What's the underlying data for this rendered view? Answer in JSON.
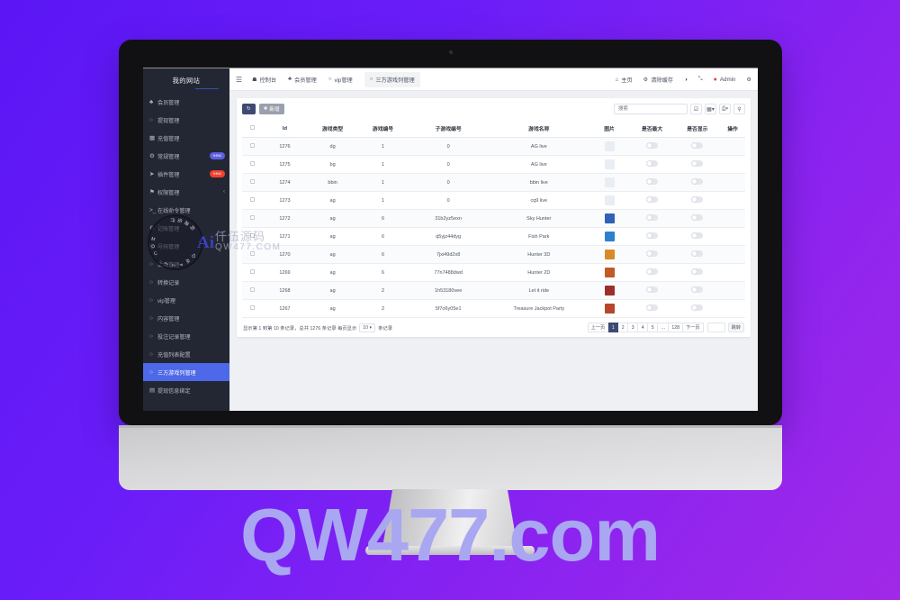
{
  "watermarks": {
    "bottom": "QW477.com",
    "circle_ring_top": "仟伍源码",
    "circle_ring_bottom": "QW477.COM",
    "logo": "Ai",
    "brand_cn": "仟伍源码",
    "brand_url": "QW477.COM"
  },
  "sidebar": {
    "brand": "我的网站",
    "items": [
      {
        "icon": "users-icon",
        "glyph": "♣",
        "label": "会员管理",
        "badge": "",
        "badge_color": "",
        "active": false,
        "chevron": ""
      },
      {
        "icon": "circle-icon",
        "glyph": "○",
        "label": "提现管理",
        "badge": "",
        "badge_color": "",
        "active": false,
        "chevron": ""
      },
      {
        "icon": "grid-icon",
        "glyph": "▦",
        "label": "充值管理",
        "badge": "",
        "badge_color": "",
        "active": false,
        "chevron": ""
      },
      {
        "icon": "gear-icon",
        "glyph": "⚙",
        "label": "常规管理",
        "badge": "new",
        "badge_color": "purple",
        "active": false,
        "chevron": ""
      },
      {
        "icon": "rocket-icon",
        "glyph": "➤",
        "label": "插件管理",
        "badge": "new",
        "badge_color": "red",
        "active": false,
        "chevron": ""
      },
      {
        "icon": "shield-icon",
        "glyph": "⚑",
        "label": "权限管理",
        "badge": "",
        "badge_color": "",
        "active": false,
        "chevron": "‹"
      },
      {
        "icon": "terminal-icon",
        "glyph": ">_",
        "label": "在线命令管理",
        "badge": "",
        "badge_color": "",
        "active": false,
        "chevron": ""
      },
      {
        "icon": "gear-icon",
        "glyph": "⚙",
        "label": "记账管理",
        "badge": "",
        "badge_color": "",
        "active": false,
        "chevron": ""
      },
      {
        "icon": "cart-icon",
        "glyph": "◎",
        "label": "号码管理",
        "badge": "",
        "badge_color": "",
        "active": false,
        "chevron": ""
      },
      {
        "icon": "circle-icon",
        "glyph": "○",
        "label": "活动管理",
        "badge": "",
        "badge_color": "",
        "active": false,
        "chevron": ""
      },
      {
        "icon": "circle-icon",
        "glyph": "○",
        "label": "转换记录",
        "badge": "",
        "badge_color": "",
        "active": false,
        "chevron": ""
      },
      {
        "icon": "circle-icon",
        "glyph": "○",
        "label": "vip管理",
        "badge": "",
        "badge_color": "",
        "active": false,
        "chevron": ""
      },
      {
        "icon": "circle-icon",
        "glyph": "○",
        "label": "内容管理",
        "badge": "",
        "badge_color": "",
        "active": false,
        "chevron": ""
      },
      {
        "icon": "circle-icon",
        "glyph": "○",
        "label": "投注记录管理",
        "badge": "",
        "badge_color": "",
        "active": false,
        "chevron": ""
      },
      {
        "icon": "circle-icon",
        "glyph": "○",
        "label": "充值列表配置",
        "badge": "",
        "badge_color": "",
        "active": false,
        "chevron": ""
      },
      {
        "icon": "circle-icon",
        "glyph": "○",
        "label": "三方游戏列管理",
        "badge": "",
        "badge_color": "",
        "active": true,
        "chevron": ""
      },
      {
        "icon": "bank-icon",
        "glyph": "▤",
        "label": "提现信息绑定",
        "badge": "",
        "badge_color": "",
        "active": false,
        "chevron": ""
      }
    ]
  },
  "topbar": {
    "menu_icon": "hamburger-icon",
    "left_items": [
      {
        "icon": "dashboard-icon",
        "glyph": "☗",
        "label": "控制台",
        "active": false
      },
      {
        "icon": "users-icon",
        "glyph": "♣",
        "label": "会员管理",
        "active": false
      },
      {
        "icon": "circle-icon",
        "glyph": "○",
        "label": "vip管理",
        "active": false
      },
      {
        "icon": "circle-icon",
        "glyph": "○",
        "label": "三方游戏列管理",
        "active": true
      }
    ],
    "right_items": [
      {
        "icon": "home-icon",
        "glyph": "⌂",
        "label": "主页"
      },
      {
        "icon": "broom-icon",
        "glyph": "⚙",
        "label": "清除缓存"
      },
      {
        "icon": "theme-icon",
        "glyph": "◑",
        "label": ""
      },
      {
        "icon": "fullscreen-icon",
        "glyph": "⤡",
        "label": ""
      },
      {
        "icon": "user-avatar-icon",
        "glyph": "●",
        "label": "Admin"
      },
      {
        "icon": "settings-icon",
        "glyph": "⚙",
        "label": ""
      }
    ]
  },
  "toolbar": {
    "refresh_label": "↻",
    "add_label": "新增",
    "add_icon": "plus-icon",
    "search_placeholder": "搜索",
    "search_value": "",
    "icon_buttons": [
      {
        "name": "export-icon",
        "glyph": "❐"
      },
      {
        "name": "columns-icon",
        "glyph": "▤▾"
      },
      {
        "name": "print-icon",
        "glyph": "⎙▾"
      },
      {
        "name": "search-icon",
        "glyph": "⌕"
      }
    ]
  },
  "table": {
    "columns": [
      "",
      "Id",
      "游戏类型",
      "游戏编号",
      "子游戏编号",
      "游戏名称",
      "图片",
      "是否最大",
      "是否显示",
      "操作"
    ],
    "rows": [
      {
        "id": "1276",
        "type": "dg",
        "game_no": "1",
        "sub_no": "0",
        "name": "AG live",
        "thumb": "#e9edf4",
        "max_on": false,
        "show_on": false
      },
      {
        "id": "1275",
        "type": "bg",
        "game_no": "1",
        "sub_no": "0",
        "name": "AG live",
        "thumb": "#e9edf4",
        "max_on": false,
        "show_on": false
      },
      {
        "id": "1274",
        "type": "bbin",
        "game_no": "1",
        "sub_no": "0",
        "name": "bbin live",
        "thumb": "#e9edf4",
        "max_on": false,
        "show_on": false
      },
      {
        "id": "1273",
        "type": "ag",
        "game_no": "1",
        "sub_no": "0",
        "name": "cq9 live",
        "thumb": "#e9edf4",
        "max_on": false,
        "show_on": false
      },
      {
        "id": "1272",
        "type": "ag",
        "game_no": "6",
        "sub_no": "31b2yz5exn",
        "name": "Sky Hunter",
        "thumb": "#2f62b8",
        "max_on": false,
        "show_on": false
      },
      {
        "id": "1271",
        "type": "ag",
        "game_no": "6",
        "sub_no": "q5yjz44dyg",
        "name": "Fish Park",
        "thumb": "#2f7fd0",
        "max_on": false,
        "show_on": false
      },
      {
        "id": "1270",
        "type": "ag",
        "game_no": "6",
        "sub_no": "7jxi49d2x8",
        "name": "Hunter 3D",
        "thumb": "#d88a2a",
        "max_on": false,
        "show_on": false
      },
      {
        "id": "1269",
        "type": "ag",
        "game_no": "6",
        "sub_no": "77n7488dwd",
        "name": "Hunter 2D",
        "thumb": "#c25a27",
        "max_on": false,
        "show_on": false
      },
      {
        "id": "1268",
        "type": "ag",
        "game_no": "2",
        "sub_no": "1h53180vee",
        "name": "Let it ride",
        "thumb": "#9c2f2c",
        "max_on": false,
        "show_on": false
      },
      {
        "id": "1267",
        "type": "ag",
        "game_no": "2",
        "sub_no": "5f7o6y05e1",
        "name": "Treasure Jackpot Party",
        "thumb": "#b8462c",
        "max_on": false,
        "show_on": false
      }
    ]
  },
  "pagination": {
    "info_prefix": "显示第 1 到第 10 条记录，总共 1276 条记录 每页显示",
    "page_size": "10",
    "info_suffix": "条记录",
    "prev_label": "上一页",
    "next_label": "下一页",
    "pages": [
      "1",
      "2",
      "3",
      "4",
      "5",
      "…",
      "128"
    ],
    "current_page": "1",
    "jump_value": "",
    "jump_label": "跳转"
  },
  "colors": {
    "sidebar_bg": "#232733",
    "active_item": "#4d68e8",
    "accent_button": "#3e4a72",
    "badge_purple": "#5d5fe3",
    "badge_red": "#f5402c",
    "background_gradient_from": "#5b16f5",
    "background_gradient_to": "#a129e8"
  }
}
